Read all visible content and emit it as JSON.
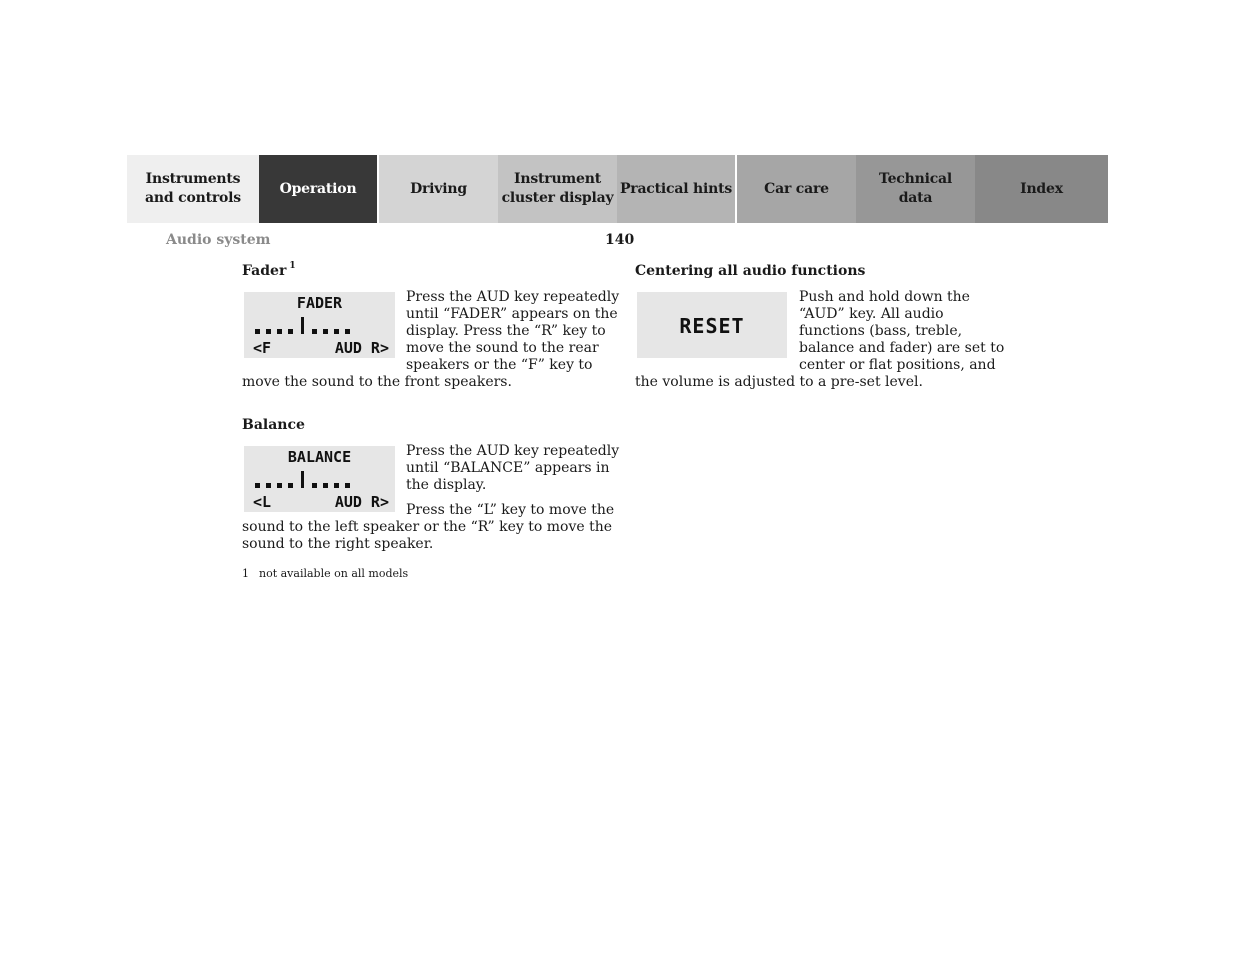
{
  "nav": {
    "tabs": [
      {
        "label": "Instruments\nand controls",
        "bg": "#efefef",
        "active": false
      },
      {
        "label": "Operation",
        "bg": "#383838",
        "active": true
      },
      {
        "label": "Driving",
        "bg": "#d4d4d4",
        "active": false
      },
      {
        "label": "Instrument\ncluster display",
        "bg": "#c3c3c3",
        "active": false
      },
      {
        "label": "Practical hints",
        "bg": "#b4b4b4",
        "active": false
      },
      {
        "label": "Car care",
        "bg": "#a6a6a6",
        "active": false
      },
      {
        "label": "Technical\ndata",
        "bg": "#979797",
        "active": false
      },
      {
        "label": "Index",
        "bg": "#888888",
        "active": false
      }
    ]
  },
  "header": {
    "section": "Audio system",
    "page_number": "140"
  },
  "fader": {
    "heading": "Fader",
    "footnote_ref": "1",
    "display": {
      "title": "FADER",
      "left_key": "<F",
      "right_keys": "AUD R>"
    },
    "text_lines": [
      "Press the AUD key repeatedly",
      "until “FADER” appears on the",
      "display. Press the “R” key to",
      "move the sound to the rear",
      "speakers or the “F” key to"
    ],
    "text_tail": "move the sound to the front speakers."
  },
  "balance": {
    "heading": "Balance",
    "display": {
      "title": "BALANCE",
      "left_key": "<L",
      "right_keys": "AUD R>"
    },
    "text_lines": [
      "Press the AUD key repeatedly",
      "until “BALANCE” appears in",
      "the display."
    ],
    "text2_first": "Press the “L” key to move the",
    "text2_tail": [
      "sound to the left speaker or the “R” key to move the",
      "sound to the right speaker."
    ]
  },
  "centering": {
    "heading": "Centering all audio functions",
    "display": {
      "title": "RESET"
    },
    "text_lines": [
      "Push and hold down the",
      "“AUD” key. All audio",
      "functions (bass, treble,",
      "balance and fader) are set to",
      "center or flat positions, and"
    ],
    "text_tail": "the volume is adjusted to a pre-set level."
  },
  "footnote": {
    "number": "1",
    "text": "not available on all models"
  }
}
